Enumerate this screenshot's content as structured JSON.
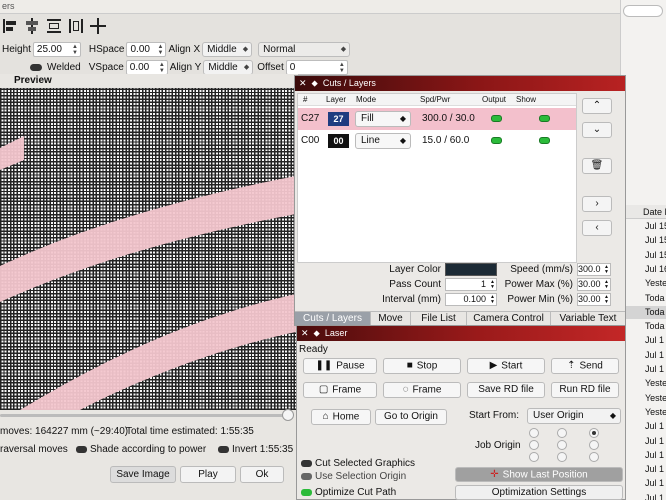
{
  "app": {
    "title_fragment": "ers"
  },
  "props": {
    "height_label": "Height",
    "height_value": "25.00",
    "hspace_label": "HSpace",
    "hspace_value": "0.00",
    "align_x_label": "Align X",
    "align_x_value": "Middle",
    "style_value": "Normal",
    "welded_label": "Welded",
    "vspace_label": "VSpace",
    "vspace_value": "0.00",
    "align_y_label": "Align Y",
    "align_y_value": "Middle",
    "offset_label": "Offset",
    "offset_value": "0"
  },
  "preview": {
    "title": "Preview",
    "moves": "moves: 164227 mm (~29:40)",
    "total_time": "Total time estimated: 1:55:35",
    "traversal_label": "raversal moves",
    "shade_label": "Shade according to power",
    "invert_label": "Invert 1:55:35",
    "save_image": "Save Image",
    "play": "Play",
    "ok": "Ok"
  },
  "cuts": {
    "title": "Cuts / Layers",
    "headers": [
      "#",
      "Layer",
      "Mode",
      "Spd/Pwr",
      "Output",
      "Show"
    ],
    "rows": [
      {
        "id": "C27",
        "layer": "27",
        "color": "#1f3c80",
        "mode": "Fill",
        "spdpwr": "300.0 / 30.0"
      },
      {
        "id": "C00",
        "layer": "00",
        "color": "#111111",
        "mode": "Line",
        "spdpwr": "15.0 / 60.0"
      }
    ],
    "layer_color_label": "Layer Color",
    "layer_color_value": "#1c2a35",
    "pass_count_label": "Pass Count",
    "pass_count_value": "1",
    "interval_label": "Interval (mm)",
    "interval_value": "0.100",
    "speed_label": "Speed (mm/s)",
    "speed_value": "300.0",
    "power_max_label": "Power Max (%)",
    "power_max_value": "30.00",
    "power_min_label": "Power Min (%)",
    "power_min_value": "30.00",
    "tabs": [
      "Cuts / Layers",
      "Move",
      "File List",
      "Camera Control",
      "Variable Text"
    ]
  },
  "laser": {
    "title": "Laser",
    "status": "Ready",
    "pause": "Pause",
    "stop": "Stop",
    "start": "Start",
    "send": "Send",
    "frame1": "Frame",
    "frame2": "Frame",
    "save_rd": "Save RD file",
    "run_rd": "Run RD file",
    "home": "Home",
    "go_to_origin": "Go to Origin",
    "start_from_label": "Start From:",
    "start_from_value": "User Origin",
    "job_origin_label": "Job Origin",
    "cut_selected": "Cut Selected Graphics",
    "use_selection_origin": "Use Selection Origin",
    "optimize_cut_path": "Optimize Cut Path",
    "show_last_position": "Show Last Position",
    "optimization_settings": "Optimization Settings"
  },
  "filelist": {
    "header": "Date M",
    "rows": [
      "Jul 15",
      "Jul 15",
      "Jul 15",
      "Jul 16",
      "Yeste",
      "Toda",
      "Toda",
      "Toda",
      "Jul 1",
      "Jul 1",
      "Jul 1",
      "Yeste",
      "Yeste",
      "Yeste",
      "Jul 1",
      "Jul 1",
      "Jul 1",
      "Jul 1",
      "Jul 1",
      "Jul 1"
    ]
  }
}
